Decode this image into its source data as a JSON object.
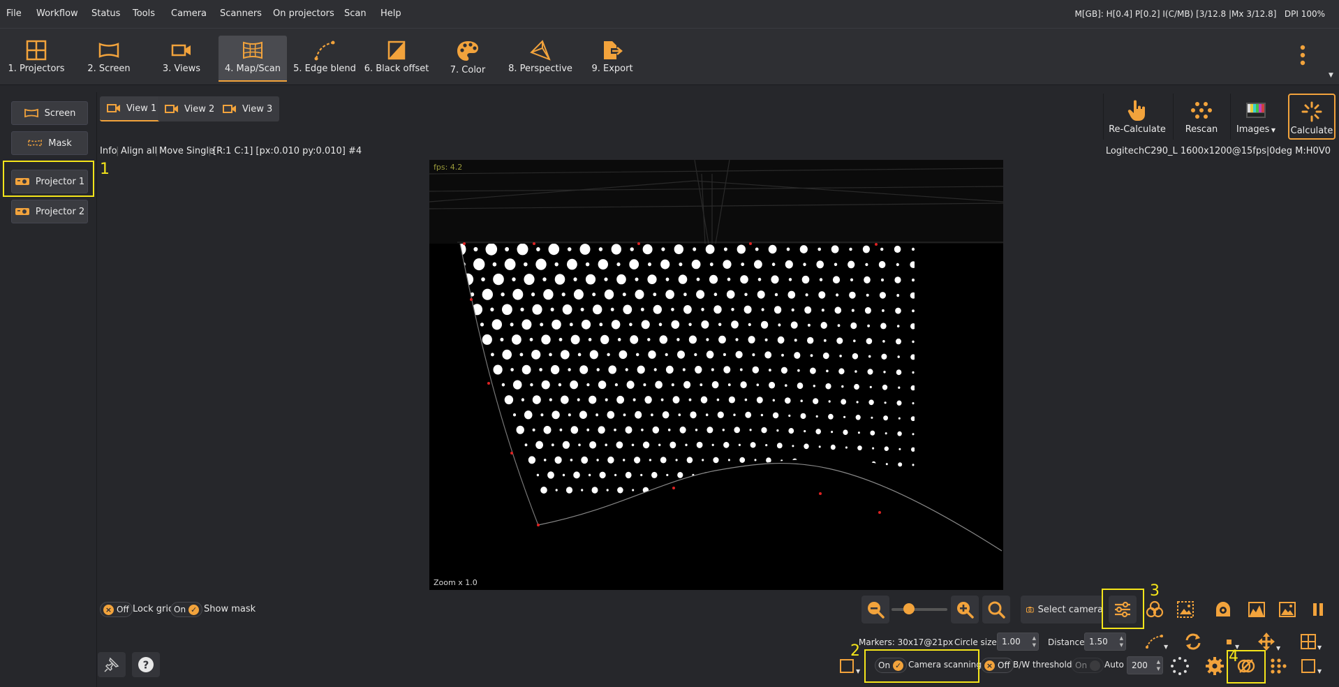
{
  "menu": [
    "File",
    "Workflow",
    "Status",
    "Tools",
    "Camera",
    "Scanners",
    "On projectors",
    "Scan",
    "Help"
  ],
  "status_text": "M[GB]: H[0.4] P[0.2] I(C/MB) [3/12.8 |Mx 3/12.8]",
  "dpi": "DPI 100%",
  "workflow_steps": [
    "1. Projectors",
    "2. Screen",
    "3. Views",
    "4. Map/Scan",
    "5. Edge blend",
    "6. Black offset",
    "7. Color",
    "8. Perspective",
    "9. Export"
  ],
  "sidebar": {
    "screen": "Screen",
    "mask": "Mask",
    "projectors": [
      "Projector 1",
      "Projector 2"
    ]
  },
  "view_tabs": [
    "View 1",
    "View 2",
    "View 3"
  ],
  "actions": {
    "recalculate": "Re-Calculate",
    "rescan": "Rescan",
    "images": "Images",
    "calculate": "Calculate"
  },
  "info_bar": {
    "info": "Info",
    "align_all": "Align all",
    "move_single": "Move Single",
    "coords": "[R:1 C:1] [px:0.010 py:0.010] #4"
  },
  "camera_info": "LogitechC290_L 1600x1200@15fps|0deg M:H0V0",
  "viewport": {
    "fps": "fps: 4.2",
    "zoom": "Zoom x 1.0"
  },
  "highlights": [
    "1",
    "2",
    "3",
    "4"
  ],
  "bottom": {
    "lock_grid_state": "Off",
    "lock_grid_label": "Lock grid",
    "show_mask_state": "On",
    "show_mask_label": "Show mask",
    "select_camera": "Select camera",
    "markers": "Markers: 30x17@21px",
    "circle_size_label": "Circle size",
    "circle_size_value": "1.00",
    "distance_label": "Distance",
    "distance_value": "1.50",
    "camera_scanning_state": "On",
    "camera_scanning_label": "Camera scanning",
    "bw_state": "Off",
    "bw_label": "B/W threshold",
    "auto_state": "On",
    "auto_label": "Auto",
    "auto_value": "200"
  },
  "colors": {
    "accent": "#f2a33c",
    "highlight": "#f5e51a",
    "background": "#26272b",
    "bar": "#2e2f33"
  }
}
